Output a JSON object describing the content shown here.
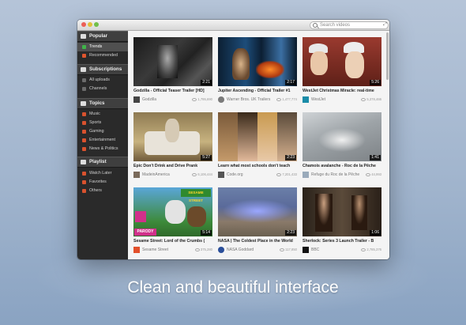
{
  "window": {
    "search_placeholder": "Search videos"
  },
  "sidebar": {
    "sections": [
      {
        "label": "Popular",
        "icon": "flame-icon",
        "items": [
          {
            "label": "Trends",
            "color": "#3fb449",
            "active": true
          },
          {
            "label": "Recommended",
            "color": "#e0552e"
          }
        ]
      },
      {
        "label": "Subscriptions",
        "icon": "subscriptions-icon",
        "items": [
          {
            "label": "All uploads",
            "color": "#6b6b6b"
          },
          {
            "label": "Channels",
            "color": "#6b6b6b"
          }
        ]
      },
      {
        "label": "Topics",
        "icon": "topics-icon",
        "items": [
          {
            "label": "Music",
            "color": "#d9522e"
          },
          {
            "label": "Sports",
            "color": "#d9522e"
          },
          {
            "label": "Gaming",
            "color": "#d9522e"
          },
          {
            "label": "Entertainment",
            "color": "#d9522e"
          },
          {
            "label": "News & Politics",
            "color": "#d9522e"
          }
        ]
      },
      {
        "label": "Playlist",
        "icon": "playlist-icon",
        "items": [
          {
            "label": "Watch Later",
            "color": "#d9522e"
          },
          {
            "label": "Favorites",
            "color": "#d9522e"
          },
          {
            "label": "Others",
            "color": "#d9522e"
          }
        ]
      }
    ]
  },
  "videos": [
    {
      "title": "Godzilla - Official Teaser Trailer [HD]",
      "channel": "Godzilla",
      "views": "1,795,690",
      "duration": "2:21"
    },
    {
      "title": "Jupiter Ascending  - Official Trailer #1",
      "channel": "Warner Bros. UK Trailers",
      "views": "1,477,774",
      "duration": "2:17"
    },
    {
      "title": "WestJet Christmas Miracle: real-time",
      "channel": "WestJet",
      "views": "5,378,466",
      "duration": "5:26"
    },
    {
      "title": "Epic Don't Drink and Drive Prank",
      "channel": "MadeinAmerica",
      "views": "6,106,444",
      "duration": "5:27"
    },
    {
      "title": "Learn what most schools don't teach",
      "channel": "Code.org",
      "views": "7,201,433",
      "duration": "2:23"
    },
    {
      "title": "Chamois avalanche - Roc de la Pêche",
      "channel": "Refuge du Roc de la Pêche",
      "views": "44,993",
      "duration": "1:41"
    },
    {
      "title": "Sesame Street: Lord of the Crumbs (",
      "channel": "Sesame Street",
      "views": "375,280",
      "duration": "5:14",
      "thumb_text": [
        "SESAME STREET",
        "PARODY"
      ]
    },
    {
      "title": "NASA | The Coldest Place in the World",
      "channel": "NASA Goddard",
      "views": "117,850",
      "duration": "2:23"
    },
    {
      "title": "Sherlock: Series 3 Launch Trailer - B",
      "channel": "BBC",
      "views": "2,785,376",
      "duration": "1:06"
    }
  ],
  "caption": "Clean and beautiful interface"
}
